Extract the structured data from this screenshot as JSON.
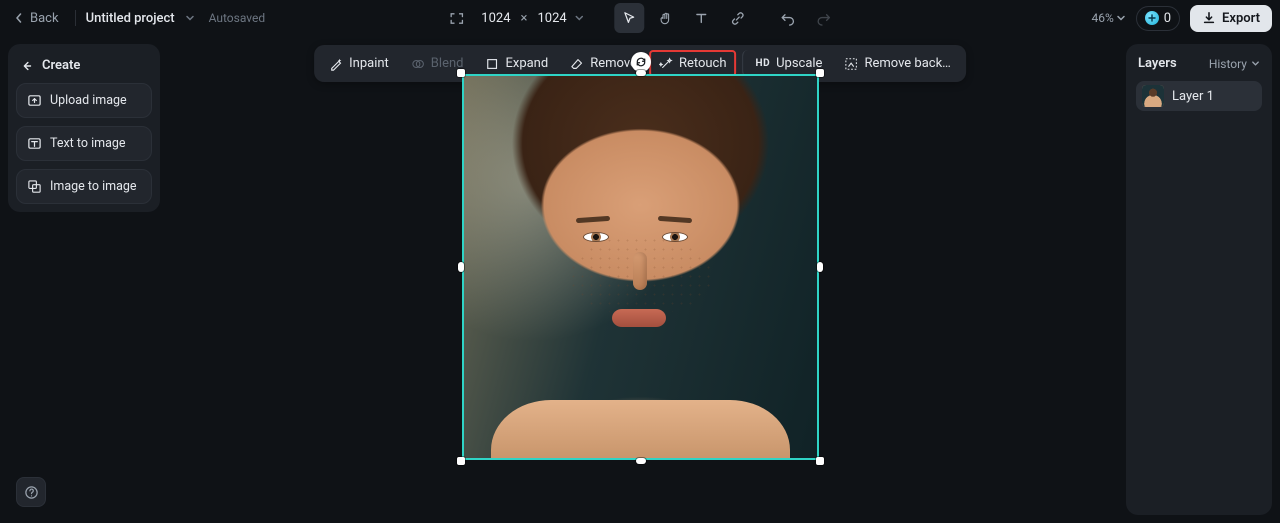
{
  "topbar": {
    "back": "Back",
    "project_title": "Untitled project",
    "autosaved": "Autosaved",
    "dim_w": "1024",
    "dim_h": "1024",
    "zoom": "46%",
    "credits": "0",
    "export": "Export"
  },
  "tools": {
    "inpaint": "Inpaint",
    "blend": "Blend",
    "expand": "Expand",
    "remove": "Remove",
    "retouch": "Retouch",
    "upscale": "Upscale",
    "remove_bg": "Remove back…"
  },
  "left": {
    "create": "Create",
    "upload": "Upload image",
    "t2i": "Text to image",
    "i2i": "Image to image"
  },
  "right": {
    "layers": "Layers",
    "history": "History",
    "layer1": "Layer 1"
  }
}
